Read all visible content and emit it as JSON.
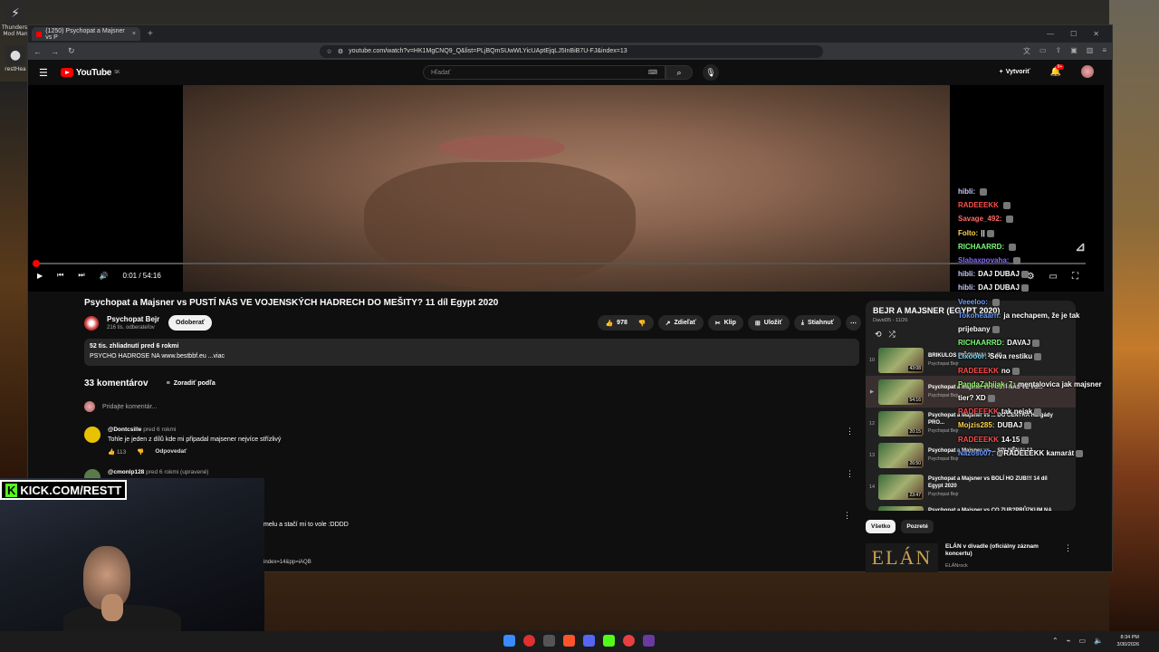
{
  "desktop": {
    "icon1_label": "Thunderst Mod Man",
    "icon2_label": "restHea"
  },
  "browser": {
    "tab_title": "(1250) Psychopat a Majsner vs P",
    "tab_close": "×",
    "new_tab": "+",
    "url": "youtube.com/watch?v=HK1MgCNQ9_Q&list=PLjBQmSUwWLYicUAptEjqLJ5InBiB7U-FJ&index=13"
  },
  "youtube": {
    "logo_text": "YouTube",
    "logo_sup": "SK",
    "search_placeholder": "Hľadať",
    "create_label": "Vytvoriť",
    "notif_count": "9+"
  },
  "player": {
    "time": "0:01 / 54:16",
    "progress_fraction": 0.0003
  },
  "video": {
    "title": "Psychopat a Majsner vs PUSTÍ NÁS VE VOJENSKÝCH HADRECH DO MEŠITY? 11 díl Egypt 2020",
    "channel_name": "Psychopat Bejr",
    "subscribers": "216 tis. odberateľov",
    "subscribe_label": "Odoberať",
    "likes": "978",
    "share_label": "Zdieľať",
    "clip_label": "Klip",
    "save_label": "Uložiť",
    "download_label": "Stiahnuť",
    "views_line": "52 tis. zhliadnutí  pred 6 rokmi",
    "desc_line": "PSYCHO HADROSE NA www.bestbbf.eu  ...viac"
  },
  "comments": {
    "count_label": "33 komentárov",
    "sort_label": "Zoradiť podľa",
    "add_placeholder": "Pridajte komentár...",
    "items": [
      {
        "user": "@Dontcsille",
        "time": "pred 6 rokmi",
        "text": "Tohle je jeden z dílů kde mi připadal majsener nejvíce střízlivý",
        "likes": "113",
        "reply": "Odpovedať"
      },
      {
        "user": "@cmonlp128",
        "time": "pred 6 rokmi (upravené)",
        "text": "",
        "likes": "",
        "reply": ""
      }
    ],
    "partial_text": "melu a stačí mi to vole :DDDD",
    "partial_url": "index=14&pp=iAQB"
  },
  "playlist": {
    "title": "BEJR A MAJSNER (EGYPT 2020)",
    "sub": "David35 - 11/26",
    "items": [
      {
        "num": "10",
        "title": "BRIKULOS PIČOVINA! 10 díl",
        "channel": "Psychopat Bejr",
        "dur": "43:08"
      },
      {
        "num": "▶",
        "title": "Psychopat a Majsner vs PUSTÍ NÁS VE VO...",
        "channel": "Psychopat Bejr",
        "dur": "54:16"
      },
      {
        "num": "12",
        "title": "Psychopat a Majsner vs ... DO CENTRA Hurgády PRO...",
        "channel": "Psychopat Bejr",
        "dur": "20:15"
      },
      {
        "num": "13",
        "title": "Psychopat a Majsner vs ... SPLNĚNA! 13...",
        "channel": "Psychopat Bejr",
        "dur": "26:50"
      },
      {
        "num": "14",
        "title": "Psychopat a Majsner vs BOLÍ HO ZUB!!! 14 díl Egypt 2020",
        "channel": "Psychopat Bejr",
        "dur": "23:47"
      },
      {
        "num": "15",
        "title": "Psychopat a Majsner vs CO ZUB?PRŮZKUM NA KOLE",
        "channel": "Psychopat Bejr",
        "dur": ""
      }
    ]
  },
  "chips": {
    "all": "Všetko",
    "watched": "Pozreté"
  },
  "recommendation": {
    "thumb_text": "ELÁN",
    "title": "ELÁN v divadle (oficiálny záznam koncertu)",
    "channel": "ELÁNrock"
  },
  "chat": [
    {
      "user": "hibli:",
      "color": "#c9c9ff",
      "msg": ""
    },
    {
      "user": "RADEEEKK",
      "color": "#ff4d4d",
      "msg": ""
    },
    {
      "user": "Savage_492:",
      "color": "#ff6b6b",
      "msg": ""
    },
    {
      "user": "Folto:",
      "color": "#ffd54d",
      "msg": "||"
    },
    {
      "user": "RICHAARRD:",
      "color": "#7cfc7c",
      "msg": ""
    },
    {
      "user": "Slabaxpovaha:",
      "color": "#8a6bff",
      "msg": ""
    },
    {
      "user": "hibli:",
      "color": "#c9c9ff",
      "msg": "DAJ DUBAJ"
    },
    {
      "user": "hibli:",
      "color": "#c9c9ff",
      "msg": "DAJ DUBAJ"
    },
    {
      "user": "Veeeloo:",
      "color": "#6b9bff",
      "msg": ""
    },
    {
      "user": "Tokoheaarn:",
      "color": "#6b9bff",
      "msg": "ja nechapem, že je tak prijebany"
    },
    {
      "user": "RICHAARRD:",
      "color": "#7cfc7c",
      "msg": "DAVAJ"
    },
    {
      "user": "Lixooor:",
      "color": "#6bdcff",
      "msg": "Seva restiku"
    },
    {
      "user": "RADEEEKK",
      "color": "#ff4d4d",
      "msg": "no"
    },
    {
      "user": "PandaZabijak_7:",
      "color": "#9bff6b",
      "msg": "mentalovica jak majsner tier? XD"
    },
    {
      "user": "RADEEEKK",
      "color": "#ff4d4d",
      "msg": "tak nejak"
    },
    {
      "user": "Mojzis285:",
      "color": "#ffd54d",
      "msg": "DUBAJ"
    },
    {
      "user": "RADEEEKK",
      "color": "#ff4d4d",
      "msg": "14-15"
    },
    {
      "user": "Nazos007:",
      "color": "#6b9bff",
      "msg": "@RADEEEKK kamarát"
    }
  ],
  "stream": {
    "kick_label": "KICK.COM/RESTT"
  },
  "taskbar": {
    "time": "8:34 PM",
    "date": "3/30/2026"
  }
}
